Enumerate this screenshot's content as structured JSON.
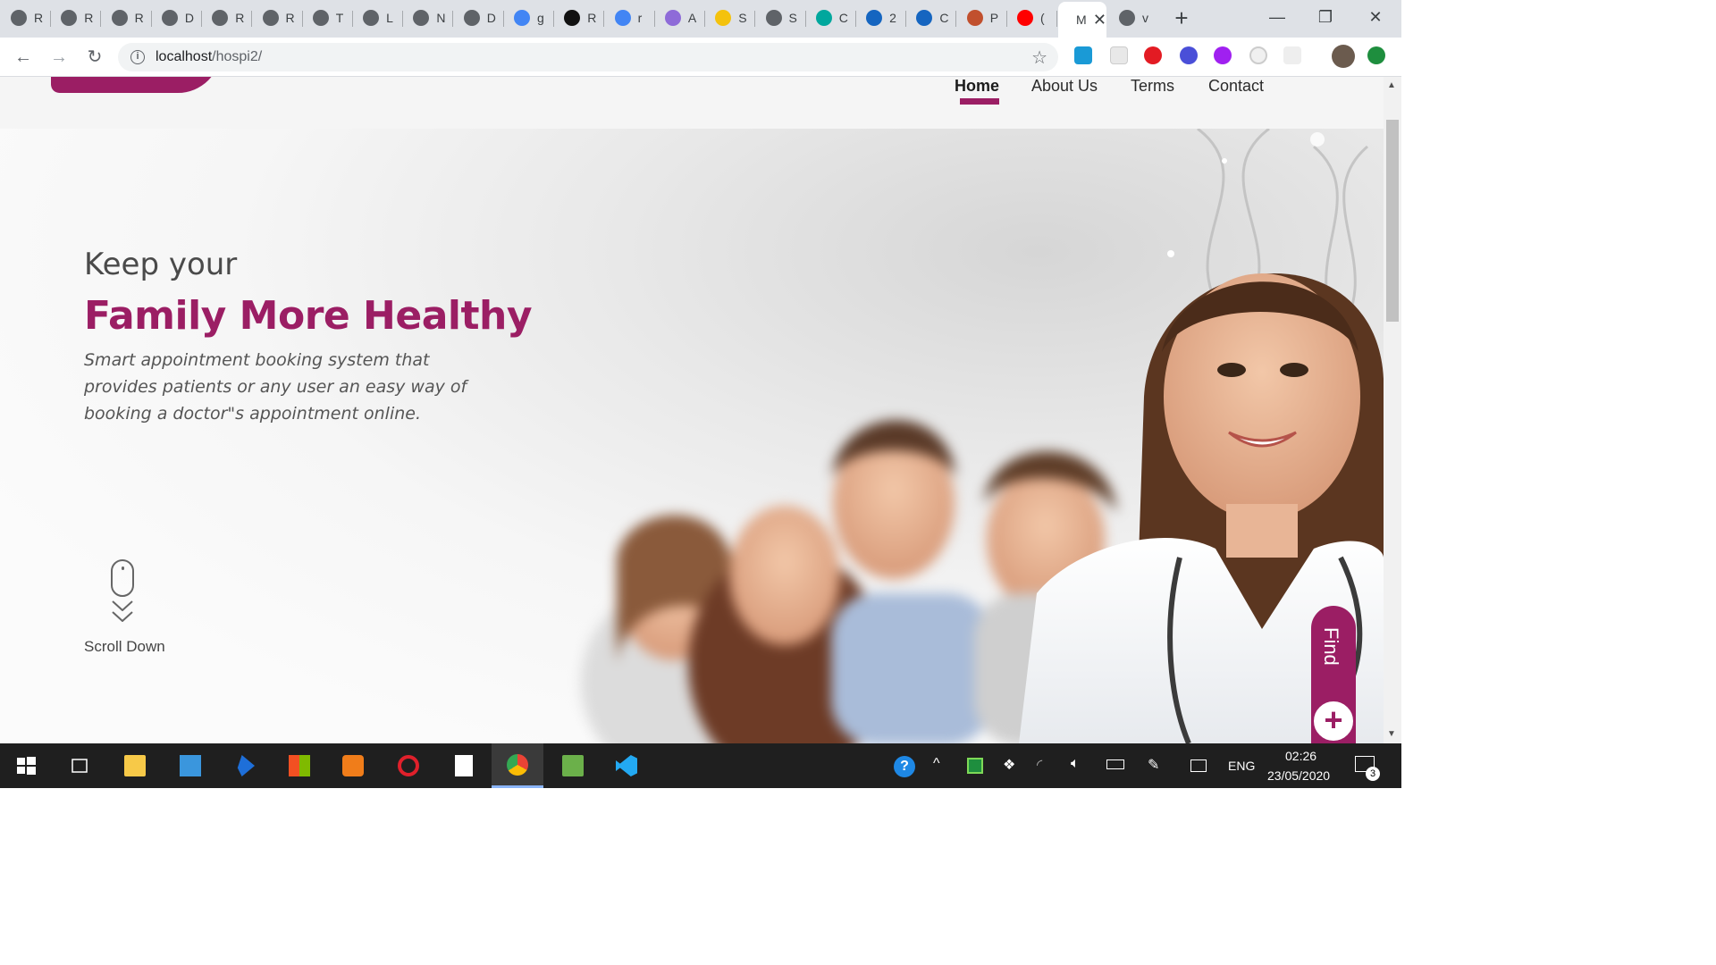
{
  "browser": {
    "tabs": [
      {
        "letter": "R",
        "icon": "globe-icon"
      },
      {
        "letter": "R",
        "icon": "globe-icon"
      },
      {
        "letter": "R",
        "icon": "globe-icon"
      },
      {
        "letter": "D",
        "icon": "globe-icon"
      },
      {
        "letter": "R",
        "icon": "globe-icon"
      },
      {
        "letter": "R",
        "icon": "globe-icon"
      },
      {
        "letter": "T",
        "icon": "globe-icon"
      },
      {
        "letter": "L",
        "icon": "globe-icon"
      },
      {
        "letter": "N",
        "icon": "globe-icon"
      },
      {
        "letter": "D",
        "icon": "globe-icon"
      },
      {
        "letter": "g",
        "icon": "google-icon"
      },
      {
        "letter": "R",
        "icon": "codepen-icon"
      },
      {
        "letter": "r",
        "icon": "google-icon"
      },
      {
        "letter": "A",
        "icon": "knot-icon"
      },
      {
        "letter": "S",
        "icon": "badge-icon"
      },
      {
        "letter": "S",
        "icon": "globe-icon"
      },
      {
        "letter": "C",
        "icon": "diamond-icon"
      },
      {
        "letter": "2",
        "icon": "pointer-icon"
      },
      {
        "letter": "C",
        "icon": "pointer-icon"
      },
      {
        "letter": "P",
        "icon": "a-logo-icon"
      },
      {
        "letter": "(",
        "icon": "youtube-icon"
      }
    ],
    "active_tab": {
      "letter": "M",
      "close": "✕"
    },
    "after_tab": {
      "letter": "v",
      "icon": "globe-icon"
    },
    "new_tab": "+",
    "window": {
      "minimize": "—",
      "restore": "❐",
      "close": "✕"
    },
    "url_host": "localhost",
    "url_path": "/hospi2/",
    "colors": {
      "accent": "#9b1e64",
      "tabstrip": "#dee1e6"
    }
  },
  "site": {
    "nav": [
      {
        "label": "Home",
        "active": true
      },
      {
        "label": "About Us",
        "active": false
      },
      {
        "label": "Terms",
        "active": false
      },
      {
        "label": "Contact",
        "active": false
      }
    ],
    "hero": {
      "subtitle": "Keep your",
      "title": "Family More Healthy",
      "description": "Smart appointment booking system that provides patients or any user an easy way of booking a doctor\"s appointment online.",
      "scroll_label": "Scroll Down"
    },
    "find_tab": {
      "label": "Find",
      "plus": "+"
    }
  },
  "taskbar": {
    "language": "ENG",
    "time": "02:26",
    "date": "23/05/2020",
    "notifications": "3"
  }
}
